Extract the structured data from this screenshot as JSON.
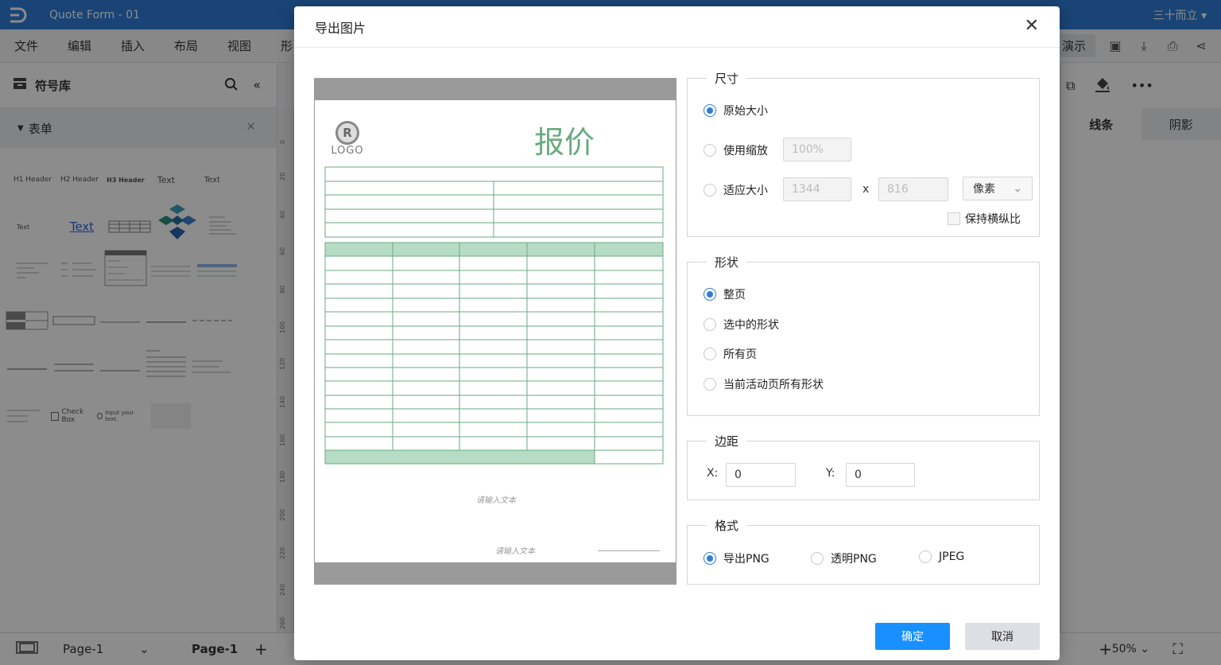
{
  "app": {
    "doc_title": "Quote Form - 01",
    "user_name": "三十而立"
  },
  "menu": [
    "文件",
    "编辑",
    "插入",
    "布局",
    "视图",
    "形"
  ],
  "toolbar": {
    "present_label": "演示"
  },
  "sidebar": {
    "library_title": "符号库",
    "category_title": "表单",
    "shape_labels": [
      "H1 Header",
      "H2 Header",
      "H3 Header",
      "Text",
      "Text",
      "Text",
      "Text",
      "Check Box",
      "Input your text."
    ]
  },
  "ruler_ticks": [
    "0",
    "20",
    "40",
    "60",
    "80",
    "100",
    "120",
    "140",
    "160",
    "180",
    "200",
    "220",
    "240",
    "260"
  ],
  "right_panel": {
    "tabs": [
      "线条",
      "阴影"
    ]
  },
  "bottom": {
    "page_select": "Page-1",
    "page_tab": "Page-1",
    "zoom": "50%"
  },
  "dialog": {
    "title": "导出图片",
    "preview": {
      "logo_text": "LOGO",
      "logo_mark": "R",
      "heading": "报价",
      "placeholder_1": "请输入文本",
      "placeholder_2": "请输入文本"
    },
    "size": {
      "legend": "尺寸",
      "original_label": "原始大小",
      "scale_label": "使用缩放",
      "scale_value": "100%",
      "fit_label": "适应大小",
      "width_value": "1344",
      "times": "x",
      "height_value": "816",
      "unit": "像素",
      "keep_ratio_label": "保持横纵比"
    },
    "shape": {
      "legend": "形状",
      "options": [
        "整页",
        "选中的形状",
        "所有页",
        "当前活动页所有形状"
      ]
    },
    "margin": {
      "legend": "边距",
      "x_label": "X:",
      "x_value": "0",
      "y_label": "Y:",
      "y_value": "0"
    },
    "format": {
      "legend": "格式",
      "options": [
        "导出PNG",
        "透明PNG",
        "JPEG"
      ]
    },
    "ok_label": "确定",
    "cancel_label": "取消"
  },
  "colors": {
    "brand_blue": "#2f7dd6",
    "primary_button": "#1890ff",
    "table_green": "#6aaa7f",
    "table_fill": "#b7dcc5"
  }
}
